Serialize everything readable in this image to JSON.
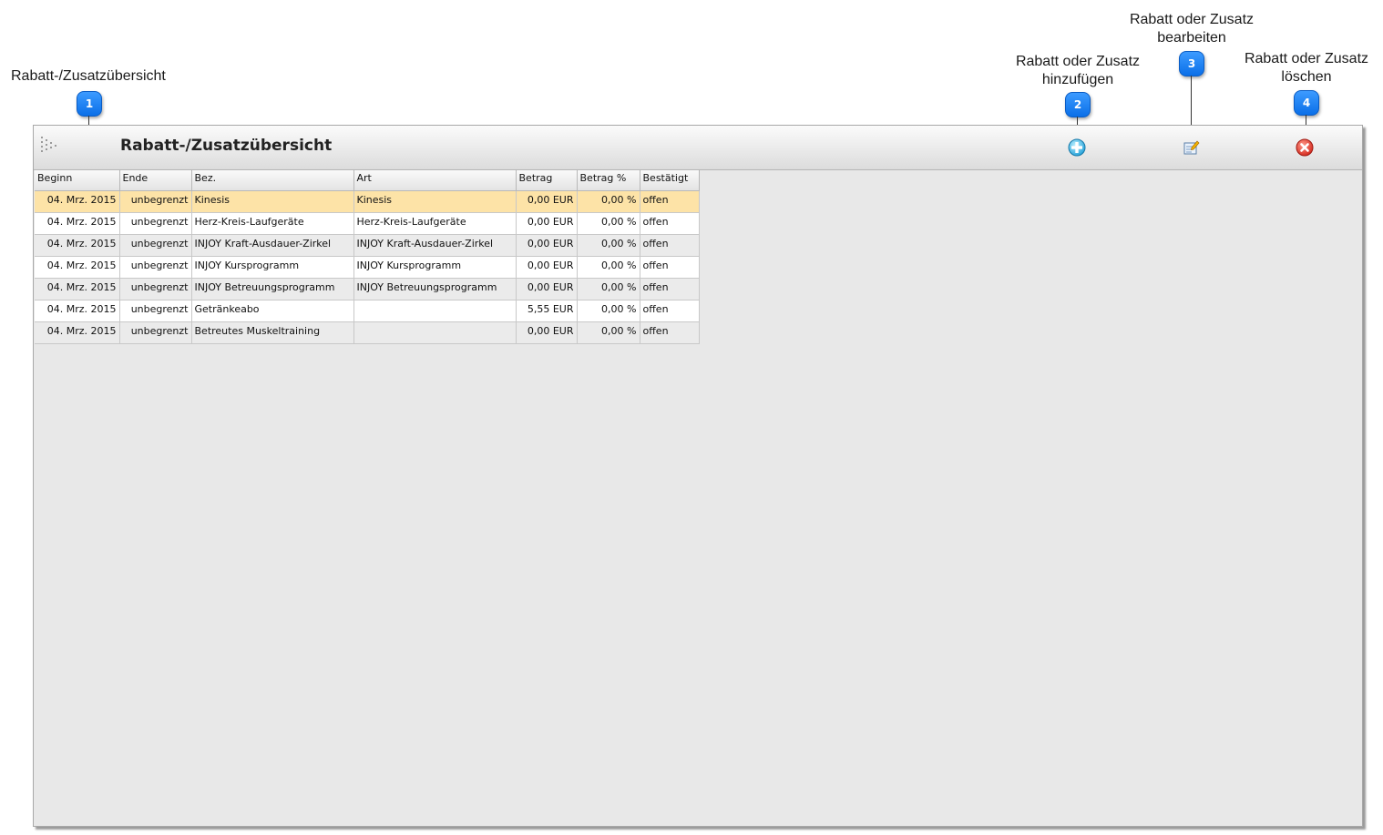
{
  "callouts": [
    {
      "num": "1",
      "label": "Rabatt-/Zusatzübersicht"
    },
    {
      "num": "2",
      "label_line1": "Rabatt oder Zusatz",
      "label_line2": "hinzufügen"
    },
    {
      "num": "3",
      "label_line1": "Rabatt oder Zusatz",
      "label_line2": "bearbeiten"
    },
    {
      "num": "4",
      "label_line1": "Rabatt oder Zusatz",
      "label_line2": "löschen"
    }
  ],
  "panel": {
    "title": "Rabatt-/Zusatzübersicht",
    "toolbar": {
      "add_icon": "add-circle-icon",
      "edit_icon": "edit-note-icon",
      "delete_icon": "delete-circle-icon"
    }
  },
  "table": {
    "columns": [
      "Beginn",
      "Ende",
      "Bez.",
      "Art",
      "Betrag",
      "Betrag %",
      "Bestätigt"
    ],
    "rows": [
      [
        "04. Mrz. 2015",
        "unbegrenzt",
        "Kinesis",
        "Kinesis",
        "0,00 EUR",
        "0,00 %",
        "offen"
      ],
      [
        "04. Mrz. 2015",
        "unbegrenzt",
        "Herz-Kreis-Laufgeräte",
        "Herz-Kreis-Laufgeräte",
        "0,00 EUR",
        "0,00 %",
        "offen"
      ],
      [
        "04. Mrz. 2015",
        "unbegrenzt",
        "INJOY Kraft-Ausdauer-Zirkel",
        "INJOY Kraft-Ausdauer-Zirkel",
        "0,00 EUR",
        "0,00 %",
        "offen"
      ],
      [
        "04. Mrz. 2015",
        "unbegrenzt",
        "INJOY Kursprogramm",
        "INJOY Kursprogramm",
        "0,00 EUR",
        "0,00 %",
        "offen"
      ],
      [
        "04. Mrz. 2015",
        "unbegrenzt",
        "INJOY Betreuungsprogramm",
        "INJOY Betreuungsprogramm",
        "0,00 EUR",
        "0,00 %",
        "offen"
      ],
      [
        "04. Mrz. 2015",
        "unbegrenzt",
        "Getränkeabo",
        "",
        "5,55 EUR",
        "0,00 %",
        "offen"
      ],
      [
        "04. Mrz. 2015",
        "unbegrenzt",
        "Betreutes Muskeltraining",
        "",
        "0,00 EUR",
        "0,00 %",
        "offen"
      ]
    ],
    "selected_row": 0
  },
  "colors": {
    "callout_badge": "#0a6fe8",
    "selected_row": "#fde3a7",
    "panel_bg": "#e8e8e8"
  }
}
